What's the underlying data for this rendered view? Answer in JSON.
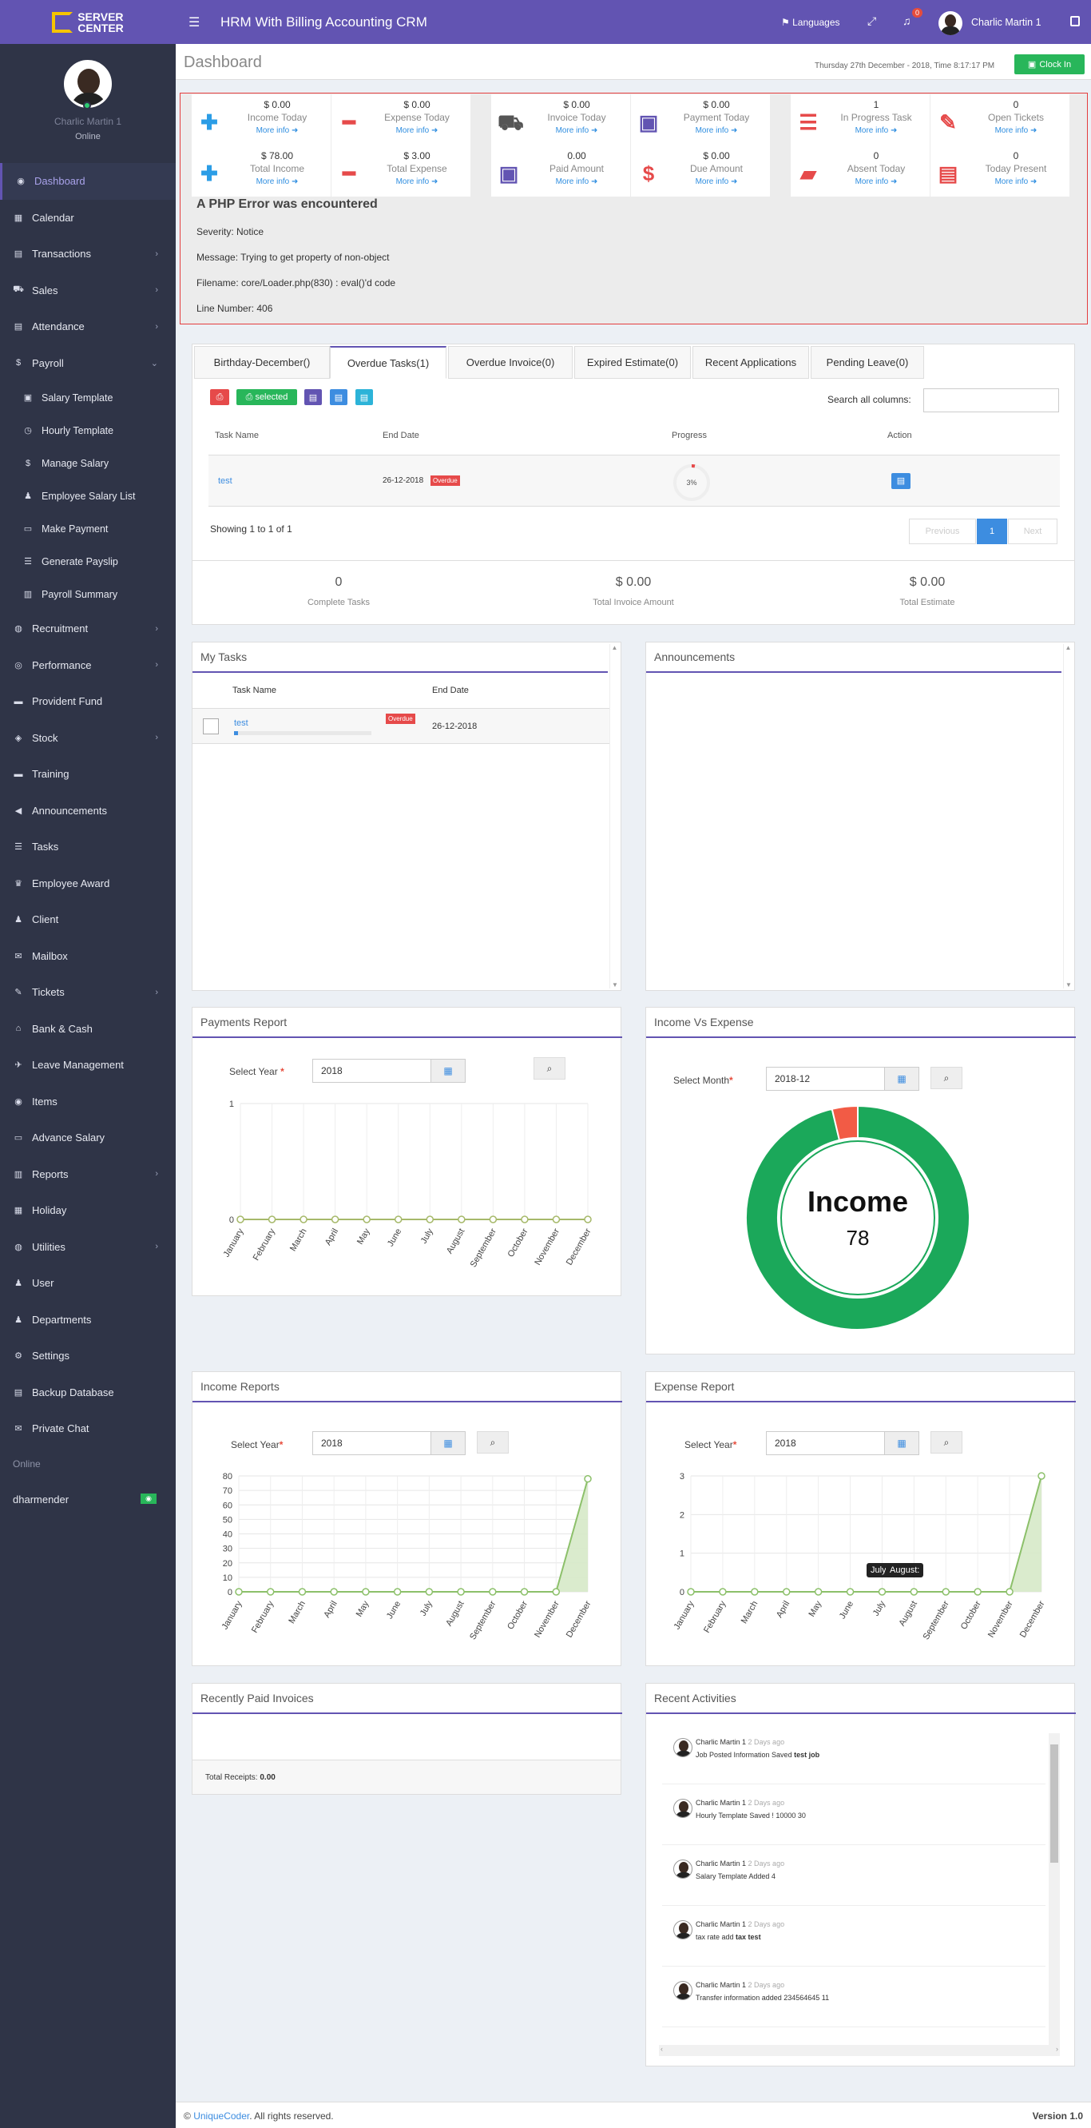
{
  "brand": {
    "line1": "SERVER",
    "line2": "CENTER"
  },
  "profile": {
    "name": "Charlic Martin 1",
    "status": "Online"
  },
  "nav": [
    {
      "label": "Dashboard",
      "icon": "dashboard-icon",
      "glyph": "◉",
      "active": true
    },
    {
      "label": "Calendar",
      "icon": "calendar-icon",
      "glyph": "▦"
    },
    {
      "label": "Transactions",
      "icon": "book-icon",
      "glyph": "▤",
      "chev": "›"
    },
    {
      "label": "Sales",
      "icon": "cart-icon",
      "glyph": "⛟",
      "chev": "›"
    },
    {
      "label": "Attendance",
      "icon": "file-icon",
      "glyph": "▤",
      "chev": "›"
    },
    {
      "label": "Payroll",
      "icon": "dollar-icon",
      "glyph": "$",
      "chev": "⌄"
    },
    {
      "label": "Salary Template",
      "icon": "money-icon",
      "glyph": "▣",
      "sub": true
    },
    {
      "label": "Hourly Template",
      "icon": "clock-icon",
      "glyph": "◷",
      "sub": true
    },
    {
      "label": "Manage Salary",
      "icon": "dollar-icon",
      "glyph": "$",
      "sub": true
    },
    {
      "label": "Employee Salary List",
      "icon": "user-secret-icon",
      "glyph": "♟",
      "sub": true
    },
    {
      "label": "Make Payment",
      "icon": "card-icon",
      "glyph": "▭",
      "sub": true
    },
    {
      "label": "Generate Payslip",
      "icon": "list-icon",
      "glyph": "☰",
      "sub": true
    },
    {
      "label": "Payroll Summary",
      "icon": "bar-icon",
      "glyph": "▥",
      "sub": true
    },
    {
      "label": "Recruitment",
      "icon": "globe-icon",
      "glyph": "◍",
      "chev": "›"
    },
    {
      "label": "Performance",
      "icon": "shield-icon",
      "glyph": "◎",
      "chev": "›"
    },
    {
      "label": "Provident Fund",
      "icon": "briefcase-icon",
      "glyph": "▬"
    },
    {
      "label": "Stock",
      "icon": "cubes-icon",
      "glyph": "◈",
      "chev": "›"
    },
    {
      "label": "Training",
      "icon": "suitcase-icon",
      "glyph": "▬"
    },
    {
      "label": "Announcements",
      "icon": "bullhorn-icon",
      "glyph": "◀"
    },
    {
      "label": "Tasks",
      "icon": "tasks-icon",
      "glyph": "☰"
    },
    {
      "label": "Employee Award",
      "icon": "trophy-icon",
      "glyph": "♛"
    },
    {
      "label": "Client",
      "icon": "users-icon",
      "glyph": "♟"
    },
    {
      "label": "Mailbox",
      "icon": "envelope-icon",
      "glyph": "✉"
    },
    {
      "label": "Tickets",
      "icon": "ticket-icon",
      "glyph": "✎",
      "chev": "›"
    },
    {
      "label": "Bank & Cash",
      "icon": "bank-icon",
      "glyph": "⌂"
    },
    {
      "label": "Leave Management",
      "icon": "plane-icon",
      "glyph": "✈"
    },
    {
      "label": "Items",
      "icon": "cube-icon",
      "glyph": "◉"
    },
    {
      "label": "Advance Salary",
      "icon": "card-icon",
      "glyph": "▭"
    },
    {
      "label": "Reports",
      "icon": "chart-icon",
      "glyph": "▥",
      "chev": "›"
    },
    {
      "label": "Holiday",
      "icon": "calendar-icon",
      "glyph": "▦"
    },
    {
      "label": "Utilities",
      "icon": "globe-icon",
      "glyph": "◍",
      "chev": "›"
    },
    {
      "label": "User",
      "icon": "users-icon",
      "glyph": "♟"
    },
    {
      "label": "Departments",
      "icon": "users-icon",
      "glyph": "♟"
    },
    {
      "label": "Settings",
      "icon": "cogs-icon",
      "glyph": "⚙"
    },
    {
      "label": "Backup Database",
      "icon": "database-icon",
      "glyph": "▤"
    },
    {
      "label": "Private Chat",
      "icon": "envelope-icon",
      "glyph": "✉"
    }
  ],
  "online_label": "Online",
  "online_user": "dharmender",
  "topbar": {
    "title": "HRM With Billing Accounting CRM",
    "languages": "Languages",
    "badge": "0",
    "user": "Charlic Martin 1"
  },
  "header": {
    "title": "Dashboard",
    "datetime": "Thursday 27th December - 2018, Time 8:17:17 PM",
    "clockin": "Clock In"
  },
  "stats": [
    {
      "value": "$ 0.00",
      "label": "Income Today",
      "more": "More info",
      "icon": "plus-icon",
      "glyph": "✚",
      "color": "#2b9de6"
    },
    {
      "value": "$ 0.00",
      "label": "Expense Today",
      "more": "More info",
      "icon": "minus-icon",
      "glyph": "━",
      "color": "#e64a4a"
    },
    {
      "value": "$ 0.00",
      "label": "Invoice Today",
      "more": "More info",
      "icon": "cart-icon",
      "glyph": "⛟",
      "color": "#555"
    },
    {
      "value": "$ 0.00",
      "label": "Payment Today",
      "more": "More info",
      "icon": "money-icon",
      "glyph": "▣",
      "color": "#6254b2"
    },
    {
      "value": "1",
      "label": "In Progress Task",
      "more": "More info",
      "icon": "tasks-icon",
      "glyph": "☰",
      "color": "#e64a4a"
    },
    {
      "value": "0",
      "label": "Open Tickets",
      "more": "More info",
      "icon": "ticket-icon",
      "glyph": "✎",
      "color": "#e64a4a"
    },
    {
      "value": "$ 78.00",
      "label": "Total Income",
      "more": "More info",
      "icon": "plus-icon",
      "glyph": "✚",
      "color": "#2b9de6"
    },
    {
      "value": "$ 3.00",
      "label": "Total Expense",
      "more": "More info",
      "icon": "minus-icon",
      "glyph": "━",
      "color": "#e64a4a"
    },
    {
      "value": "0.00",
      "label": "Paid Amount",
      "more": "More info",
      "icon": "money-icon",
      "glyph": "▣",
      "color": "#6254b2"
    },
    {
      "value": "$ 0.00",
      "label": "Due Amount",
      "more": "More info",
      "icon": "dollar-icon",
      "glyph": "$",
      "color": "#e64a4a"
    },
    {
      "value": "0",
      "label": "Absent Today",
      "more": "More info",
      "icon": "folder-icon",
      "glyph": "▰",
      "color": "#e64a4a"
    },
    {
      "value": "0",
      "label": "Today Present",
      "more": "More info",
      "icon": "file-icon",
      "glyph": "▤",
      "color": "#e64a4a"
    }
  ],
  "error": {
    "title": "A PHP Error was encountered",
    "lines": [
      "Severity: Notice",
      "Message: Trying to get property of non-object",
      "Filename: core/Loader.php(830) : eval()'d code",
      "Line Number: 406"
    ]
  },
  "tabs": [
    "Birthday-December()",
    "Overdue Tasks(1)",
    "Overdue Invoice(0)",
    "Expired Estimate(0)",
    "Recent Applications",
    "Pending Leave(0)"
  ],
  "table": {
    "selected_label": "selected",
    "search_label": "Search all columns:",
    "headers": [
      "Task Name",
      "End Date",
      "Progress",
      "Action"
    ],
    "rows": [
      {
        "name": "test",
        "end_date": "26-12-2018",
        "badge": "Overdue",
        "progress": "3%",
        "progress_value": 3
      }
    ],
    "showing": "Showing 1 to 1 of 1",
    "pagination": [
      "Previous",
      "1",
      "Next"
    ]
  },
  "summary": [
    {
      "value": "0",
      "label": "Complete Tasks"
    },
    {
      "value": "$ 0.00",
      "label": "Total Invoice Amount"
    },
    {
      "value": "$ 0.00",
      "label": "Total Estimate"
    }
  ],
  "my_tasks": {
    "title": "My Tasks",
    "headers": [
      "Task Name",
      "End Date"
    ],
    "rows": [
      {
        "name": "test",
        "badge": "Overdue",
        "end_date": "26-12-2018",
        "progress_value": 3
      }
    ]
  },
  "announcements": {
    "title": "Announcements"
  },
  "payments_report": {
    "title": "Payments Report",
    "label": "Select Year",
    "year": "2018"
  },
  "income_vs_expense": {
    "title": "Income Vs Expense",
    "label": "Select Month",
    "month": "2018-12",
    "center_label": "Income",
    "center_value": "78"
  },
  "income_reports": {
    "title": "Income Reports",
    "label": "Select Year",
    "year": "2018"
  },
  "expense_report": {
    "title": "Expense Report",
    "label": "Select Year",
    "year": "2018",
    "tooltip1": "July",
    "tooltip2": "August:"
  },
  "recent_invoices": {
    "title": "Recently Paid Invoices",
    "total_label": "Total Receipts:",
    "total_value": "0.00"
  },
  "recent_activities": {
    "title": "Recent Activities",
    "items": [
      {
        "user": "Charlic Martin 1",
        "time": "2 Days ago",
        "text": "Job Posted Information Saved ",
        "bold": "test job"
      },
      {
        "user": "Charlic Martin 1",
        "time": "2 Days ago",
        "text": "Hourly Template Saved ! 10000 30",
        "bold": ""
      },
      {
        "user": "Charlic Martin 1",
        "time": "2 Days ago",
        "text": "Salary Template Added 4",
        "bold": ""
      },
      {
        "user": "Charlic Martin 1",
        "time": "2 Days ago",
        "text": "tax rate add ",
        "bold": "tax test"
      },
      {
        "user": "Charlic Martin 1",
        "time": "2 Days ago",
        "text": "Transfer information added 234564645 11",
        "bold": ""
      }
    ]
  },
  "footer": {
    "prefix": "© ",
    "link": "UniqueCoder",
    "suffix": ". All rights reserved.",
    "version": "Version 1.0"
  },
  "chart_data": [
    {
      "type": "line",
      "title": "Payments Report",
      "categories": [
        "January",
        "February",
        "March",
        "April",
        "May",
        "June",
        "July",
        "August",
        "September",
        "October",
        "November",
        "December"
      ],
      "series": [
        {
          "values": [
            0,
            0,
            0,
            0,
            0,
            0,
            0,
            0,
            0,
            0,
            0,
            0
          ]
        }
      ],
      "ylim": [
        0,
        1
      ],
      "yticks": [
        0,
        1
      ],
      "color": "#a6b96a"
    },
    {
      "type": "pie",
      "title": "Income Vs Expense",
      "slices": [
        {
          "label": "Income",
          "value": 78,
          "color": "#1ba85a"
        },
        {
          "label": "Expense",
          "value": 3,
          "color": "#f25b45"
        }
      ]
    },
    {
      "type": "area",
      "title": "Income Reports",
      "categories": [
        "January",
        "February",
        "March",
        "April",
        "May",
        "June",
        "July",
        "August",
        "September",
        "October",
        "November",
        "December"
      ],
      "series": [
        {
          "values": [
            0,
            0,
            0,
            0,
            0,
            0,
            0,
            0,
            0,
            0,
            0,
            78
          ]
        }
      ],
      "ylim": [
        0,
        80
      ],
      "yticks": [
        0,
        10,
        20,
        30,
        40,
        50,
        60,
        70,
        80
      ],
      "color": "#8cc06a"
    },
    {
      "type": "area",
      "title": "Expense Report",
      "categories": [
        "January",
        "February",
        "March",
        "April",
        "May",
        "June",
        "July",
        "August",
        "September",
        "October",
        "November",
        "December"
      ],
      "series": [
        {
          "values": [
            0,
            0,
            0,
            0,
            0,
            0,
            0,
            0,
            0,
            0,
            0,
            3
          ]
        }
      ],
      "ylim": [
        0,
        3
      ],
      "yticks": [
        0,
        1,
        2,
        3
      ],
      "color": "#8cc06a"
    }
  ]
}
